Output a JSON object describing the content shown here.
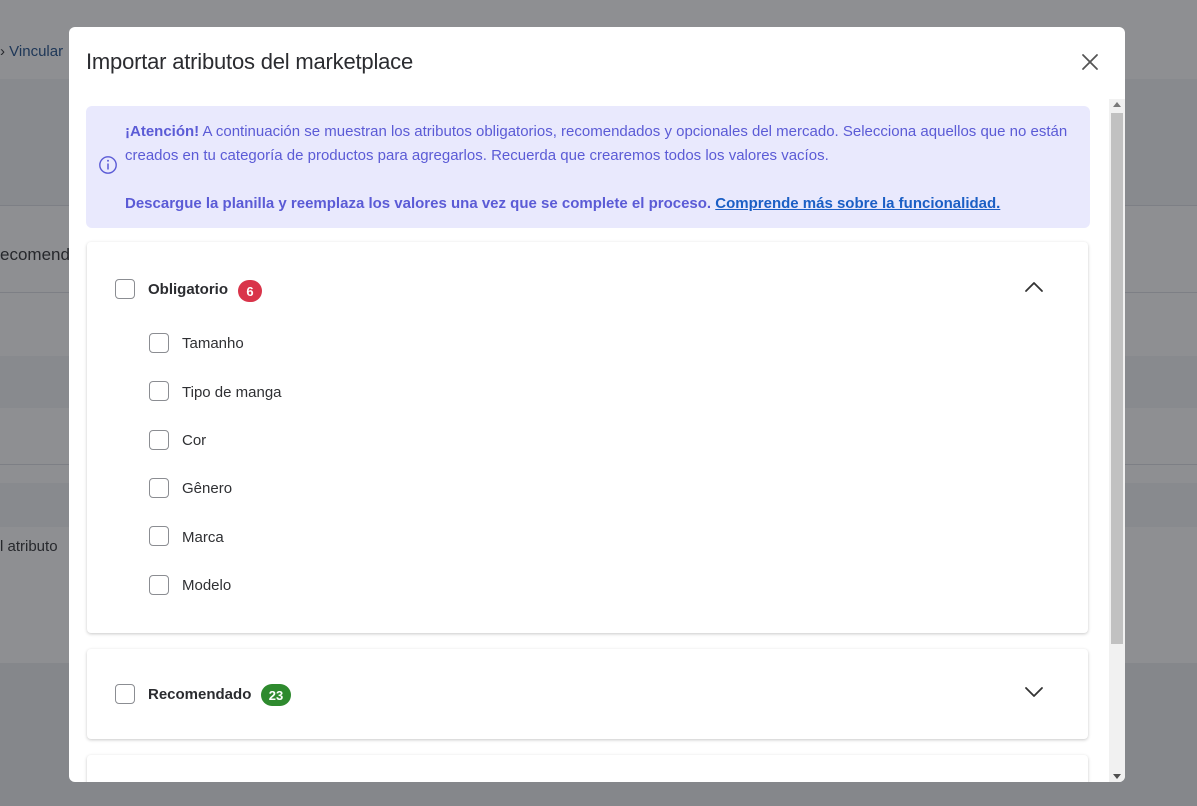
{
  "background": {
    "breadcrumb_link": "Vincular",
    "tab_fragment": "ecomend",
    "row_text": "l atributo"
  },
  "modal": {
    "title": "Importar atributos del marketplace",
    "alert": {
      "strong": "¡Atención!",
      "text": " A continuación se muestran los atributos obligatorios, recomendados y opcionales del mercado. Selecciona aquellos que no están creados en tu categoría de productos para agregarlos. Recuerda que crearemos todos los valores vacíos.",
      "download_text": "Descargue la planilla y reemplaza los valores una vez que se complete el proceso. ",
      "link": "Comprende más sobre la funcionalidad."
    },
    "groups": [
      {
        "label": "Obligatorio",
        "count": "6",
        "badge_color": "#d9344a",
        "expanded": true,
        "items": [
          "Tamanho",
          "Tipo de manga",
          "Cor",
          "Gênero",
          "Marca",
          "Modelo"
        ]
      },
      {
        "label": "Recomendado",
        "count": "23",
        "badge_color": "#2e8a2e",
        "expanded": false
      }
    ]
  },
  "icons": {
    "close": "close-icon",
    "info": "info-icon",
    "chevron_up": "chevron-up-icon",
    "chevron_down": "chevron-down-icon"
  }
}
